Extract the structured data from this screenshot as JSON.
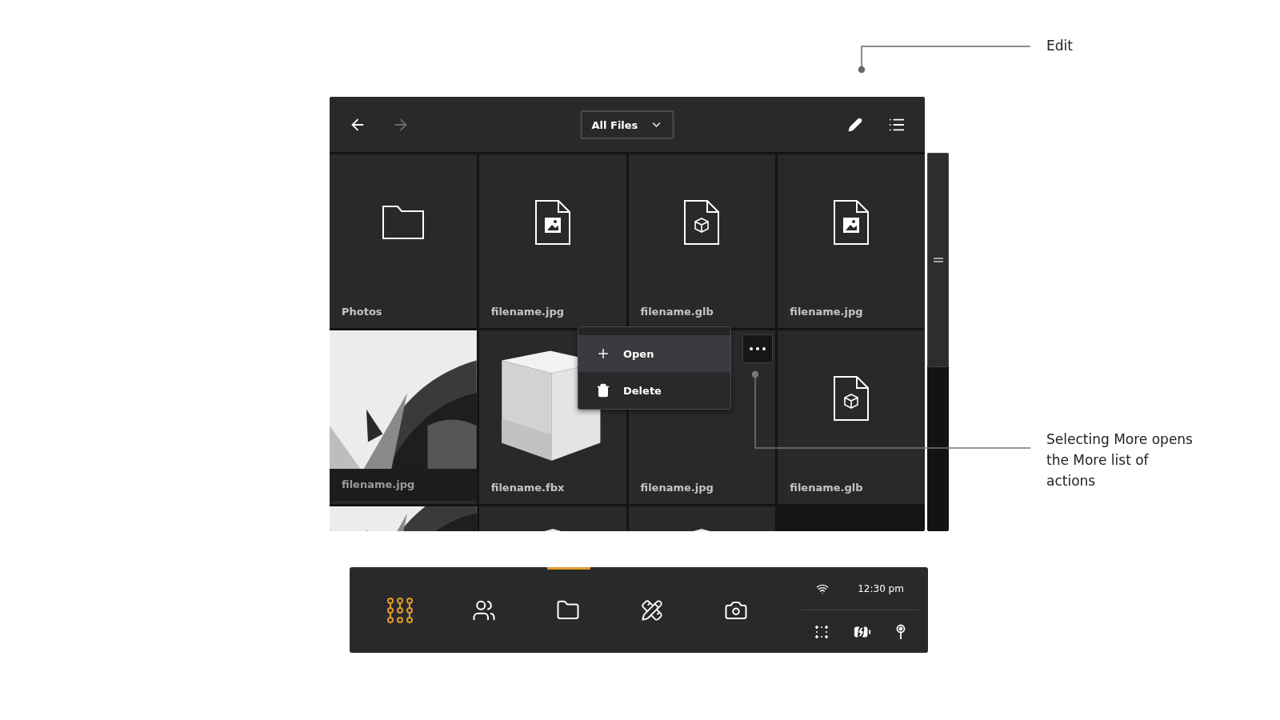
{
  "toolbar": {
    "nav": [
      {
        "kind": "back",
        "disabled": false
      },
      {
        "kind": "forward",
        "disabled": true
      }
    ],
    "filter": {
      "value": "All Files"
    },
    "actions": [
      {
        "kind": "edit"
      },
      {
        "kind": "list"
      }
    ]
  },
  "tiles": [
    {
      "kind": "folder",
      "label": "Photos"
    },
    {
      "kind": "image-file",
      "label": "filename.jpg"
    },
    {
      "kind": "model-file",
      "label": "filename.glb"
    },
    {
      "kind": "image-file",
      "label": "filename.jpg"
    },
    {
      "label": "filename.jpg"
    },
    {
      "kind": "render",
      "label": "filename.fbx"
    },
    {
      "kind": "covered",
      "label": "filename.jpg"
    },
    {
      "kind": "model-file",
      "label": "filename.glb"
    },
    {
      "kind": "photo-partial"
    },
    {
      "kind": "render-partial"
    },
    {
      "kind": "render-partial"
    },
    {
      "kind": "empty"
    }
  ],
  "more_menu": {
    "items": [
      {
        "kind": "open",
        "label": "Open",
        "selected": true
      },
      {
        "kind": "delete",
        "label": "Delete",
        "selected": false
      }
    ]
  },
  "taskbar": {
    "items": [
      {
        "kind": "apps",
        "active": true,
        "selected": false
      },
      {
        "kind": "people",
        "active": false,
        "selected": false
      },
      {
        "kind": "files",
        "active": false,
        "selected": true
      },
      {
        "kind": "tools",
        "active": false,
        "selected": false
      },
      {
        "kind": "camera",
        "active": false,
        "selected": false
      }
    ],
    "status": {
      "time": "12:30 pm"
    }
  },
  "annotations": [
    {
      "kind": "edit",
      "text": "Edit"
    },
    {
      "kind": "more",
      "text": "Selecting More opens the More list of actions"
    }
  ]
}
